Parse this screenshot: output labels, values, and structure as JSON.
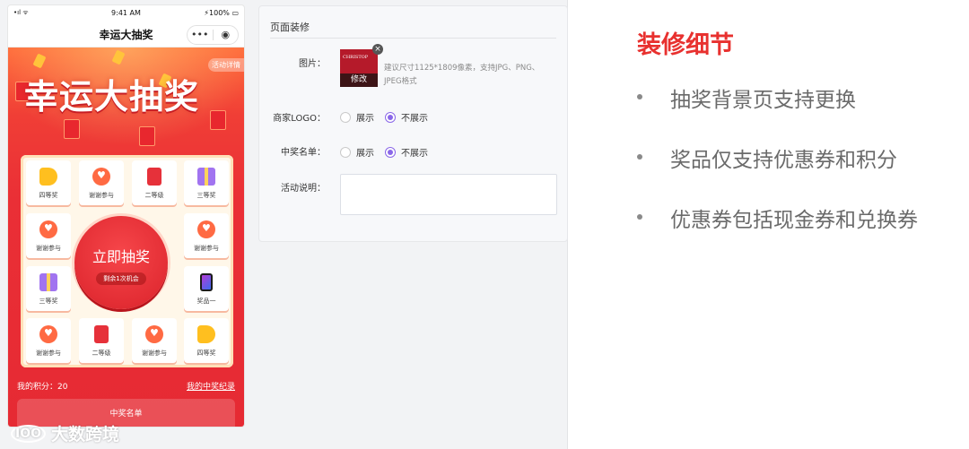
{
  "phone": {
    "status": {
      "signal": "•ıl ᯤ",
      "time": "9:41 AM",
      "battery": "⚡100% ▭"
    },
    "nav_title": "幸运大抽奖",
    "capsule": {
      "more": "•••",
      "close": "◉"
    },
    "activity_details": "活动详情",
    "hero_title": "幸运大抽奖",
    "prizes": [
      {
        "label": "四等奖",
        "icon": "coin-icon"
      },
      {
        "label": "谢谢参与",
        "icon": "heart-icon"
      },
      {
        "label": "二等级",
        "icon": "red-envelope-icon"
      },
      {
        "label": "三等奖",
        "icon": "gift-icon"
      },
      {
        "label": "谢谢参与",
        "icon": "heart-icon"
      },
      {
        "label": "谢谢参与",
        "icon": "heart-icon"
      },
      {
        "label": "三等奖",
        "icon": "gift-icon"
      },
      {
        "label": "奖品一",
        "icon": "phone-icon"
      },
      {
        "label": "谢谢参与",
        "icon": "heart-icon"
      },
      {
        "label": "二等级",
        "icon": "red-envelope-icon"
      },
      {
        "label": "谢谢参与",
        "icon": "heart-icon"
      },
      {
        "label": "四等奖",
        "icon": "coin-icon"
      }
    ],
    "draw_button": {
      "label": "立即抽奖",
      "chances": "剩余1次机会"
    },
    "points": "我的积分：20",
    "my_record": "我的中奖纪录",
    "winners_list": "中奖名单"
  },
  "watermark": {
    "logo": "IOO",
    "text": "大数跨境"
  },
  "panel": {
    "title": "页面装修",
    "image_label": "图片：",
    "thumb_brand": "CHRISTOP",
    "thumb_edit": "修改",
    "thumb_close": "×",
    "image_hint": "建议尺寸1125*1809像素，支持JPG、PNG、JPEG格式",
    "logo_label": "商家LOGO：",
    "winners_label": "中奖名单：",
    "show": "展示",
    "hide": "不展示",
    "desc_label": "活动说明：",
    "desc_value": ""
  },
  "right": {
    "title": "装修细节",
    "bullets": [
      "抽奖背景页支持更换",
      "奖品仅支持优惠券和积分",
      "优惠券包括现金券和兑换券"
    ]
  },
  "colors": {
    "accent": "#e8312f",
    "radio": "#8a67e8",
    "hero": "#ea2f36"
  }
}
